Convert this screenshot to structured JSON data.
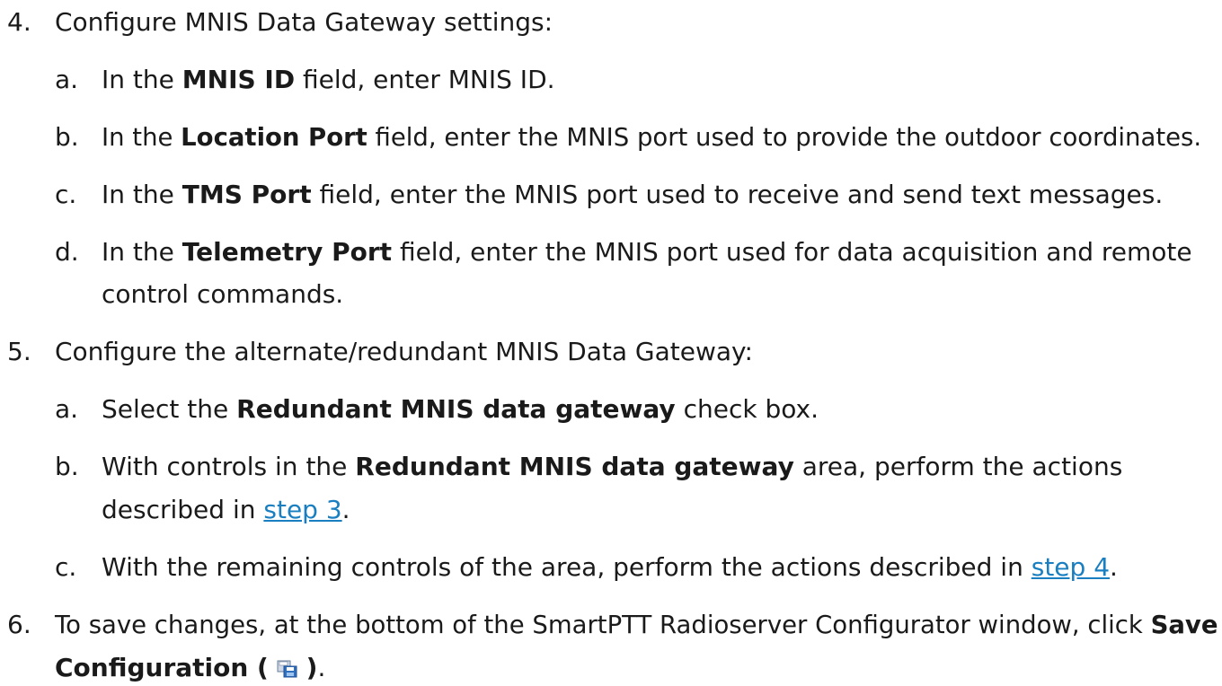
{
  "steps": {
    "s4": {
      "num": "4.",
      "text": "Configure MNIS Data Gateway settings:",
      "a": {
        "letter": "a.",
        "pre": "In the ",
        "bold": "MNIS ID",
        "post": " field, enter MNIS ID."
      },
      "b": {
        "letter": "b.",
        "pre": "In the ",
        "bold": "Location Port",
        "post": " field, enter the MNIS port used to provide the outdoor coordinates."
      },
      "c": {
        "letter": "c.",
        "pre": "In the ",
        "bold": "TMS Port",
        "post": " field, enter the MNIS port used to receive and send text messages."
      },
      "d": {
        "letter": "d.",
        "pre": "In the ",
        "bold": "Telemetry Port",
        "post": " field, enter the MNIS port used for data acquisition and remote",
        "line2": "control commands."
      }
    },
    "s5": {
      "num": "5.",
      "text": "Configure the alternate/redundant MNIS Data Gateway:",
      "a": {
        "letter": "a.",
        "pre": "Select the ",
        "bold": "Redundant MNIS data gateway",
        "post": " check box."
      },
      "b": {
        "letter": "b.",
        "pre": "With controls in the ",
        "bold": "Redundant MNIS data gateway",
        "post": " area, perform the actions",
        "line2_pre": "described in ",
        "link": "step 3",
        "line2_post": "."
      },
      "c": {
        "letter": "c.",
        "pre": "With the remaining controls of the area, perform the actions described in ",
        "link": "step 4",
        "post": "."
      }
    },
    "s6": {
      "num": "6.",
      "pre": "To save changes, at the bottom of the SmartPTT Radioserver Configurator window, click ",
      "bold1": "Save",
      "bold2": "Configuration (",
      "bold3": ")",
      "end": ".",
      "icon": "save-configuration-icon"
    }
  }
}
